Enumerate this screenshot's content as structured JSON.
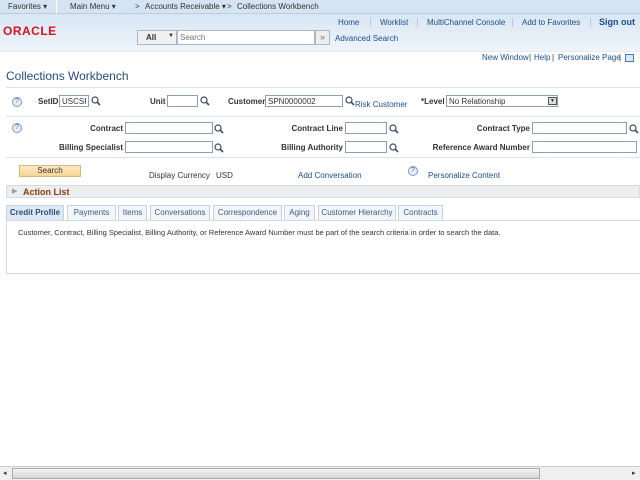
{
  "nav": {
    "favorites": "Favorites ▾",
    "main_menu": "Main Menu ▾",
    "accounts_receivable": "Accounts Receivable ▾",
    "current": "Collections Workbench",
    "sep": ">"
  },
  "header": {
    "logo": "ORACLE",
    "links": [
      "Home",
      "Worklist",
      "MultiChannel Console",
      "Add to Favorites"
    ],
    "sign_out": "Sign out",
    "search_scope": "All",
    "search_placeholder": "Search",
    "advanced_search": "Advanced Search"
  },
  "page_links": {
    "new_window": "New Window",
    "help": "Help",
    "personalize_page": "Personalize Page"
  },
  "title": "Collections Workbench",
  "form": {
    "setid": {
      "label": "SetID",
      "value": "USCSP"
    },
    "unit": {
      "label": "Unit",
      "value": ""
    },
    "customer": {
      "label": "Customer",
      "value": "SPN0000002"
    },
    "risk_customer": "Risk Customer",
    "level": {
      "label": "*Level",
      "value": "No Relationship"
    },
    "contract": {
      "label": "Contract",
      "value": ""
    },
    "contract_line": {
      "label": "Contract Line",
      "value": ""
    },
    "contract_type": {
      "label": "Contract Type",
      "value": ""
    },
    "billing_specialist": {
      "label": "Billing Specialist",
      "value": ""
    },
    "billing_authority": {
      "label": "Billing Authority",
      "value": ""
    },
    "reference_award_number": {
      "label": "Reference Award Number",
      "value": ""
    }
  },
  "actions": {
    "search": "Search",
    "display_currency_label": "Display Currency",
    "currency": "USD",
    "add_conversation": "Add Conversation",
    "personalize_content": "Personalize Content"
  },
  "action_list": "Action List",
  "tabs": [
    "Credit Profile",
    "Payments",
    "Items",
    "Conversations",
    "Correspondence",
    "Aging",
    "Customer Hierarchy",
    "Contracts"
  ],
  "message": "Customer, Contract, Billing Specialist, Billing Authority,  or Reference Award Number must be part of the search criteria in order to search the data.",
  "colors": {
    "accent": "#1c4e8a",
    "brand": "#d8131a",
    "action_list": "#8a3b12"
  }
}
